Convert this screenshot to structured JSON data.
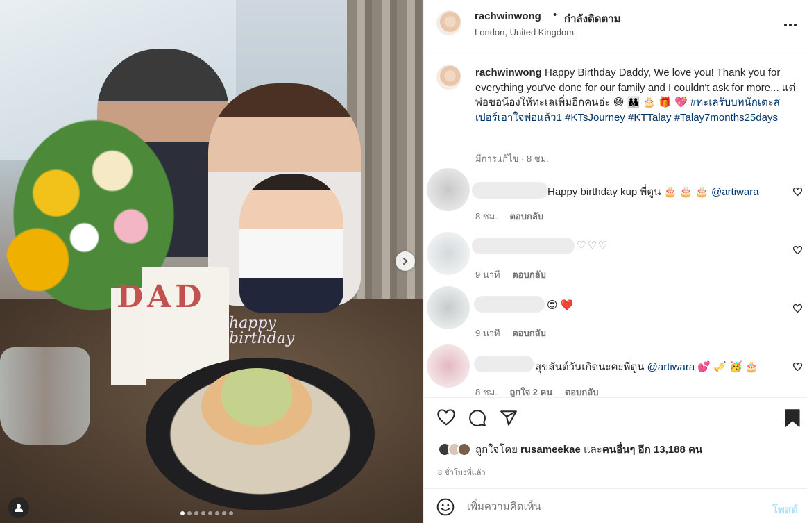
{
  "post": {
    "username": "rachwinwong",
    "dot": "•",
    "follow_status": "กำลังติดตาม",
    "location": "London, United Kingdom",
    "more_icon": "more-horizontal-icon"
  },
  "photo": {
    "card_text": "DAD",
    "topper_text": "happy birthday",
    "carousel_dots": 8,
    "active_dot": 0
  },
  "caption": {
    "username": "rachwinwong",
    "text_1": " Happy Birthday Daddy, We love you! Thank you for everything you've done for our family and I couldn't ask for more... แต่พ่อขอน้องให้ทะเลเพิ่มอีกคนอ่ะ 😅 👪 🎂 🎁 💖 ",
    "tag_1": "#ทะเลรับบทนักเตะสเปอร์เอาใจพ่อแล้ว1",
    "tag_2": "#KTsJourney",
    "tag_3": "#KTTalay",
    "tag_4": "#Talay7months25days",
    "meta": "มีการแก้ไข · 8 ชม."
  },
  "comments": [
    {
      "text": "Happy birthday kup พี่ตูน 🎂 🎂 🎂 ",
      "mention": "@artiwara",
      "time": "8 ชม.",
      "likes": "",
      "reply": "ตอบกลับ"
    },
    {
      "text": "♡♡♡",
      "mention": "",
      "time": "9 นาที",
      "likes": "",
      "reply": "ตอบกลับ"
    },
    {
      "text": "😍 ❤️",
      "mention": "",
      "time": "9 นาที",
      "likes": "",
      "reply": "ตอบกลับ"
    },
    {
      "text": "สุขสันต์วันเกิดนะคะพี่ตูน ",
      "mention": "@artiwara",
      "suffix": " 💕 🎺 🥳 🎂",
      "time": "8 ชม.",
      "likes": "ถูกใจ 2 คน",
      "reply": "ตอบกลับ"
    }
  ],
  "actions": {
    "like_icon": "heart-icon",
    "comment_icon": "comment-icon",
    "share_icon": "send-icon",
    "save_icon": "bookmark-icon"
  },
  "likes": {
    "prefix": "ถูกใจโดย ",
    "user": "rusameekae",
    "middle": " และ",
    "others": "คนอื่นๆ อีก 13,188 คน"
  },
  "posted_ago": "8 ชั่วโมงที่แล้ว",
  "add_comment": {
    "placeholder": "เพิ่มความคิดเห็น",
    "post_label": "โพสต์"
  },
  "colors": {
    "link": "#00376b",
    "post_disabled": "#b2dffc",
    "heart_red": "#ed4956"
  }
}
